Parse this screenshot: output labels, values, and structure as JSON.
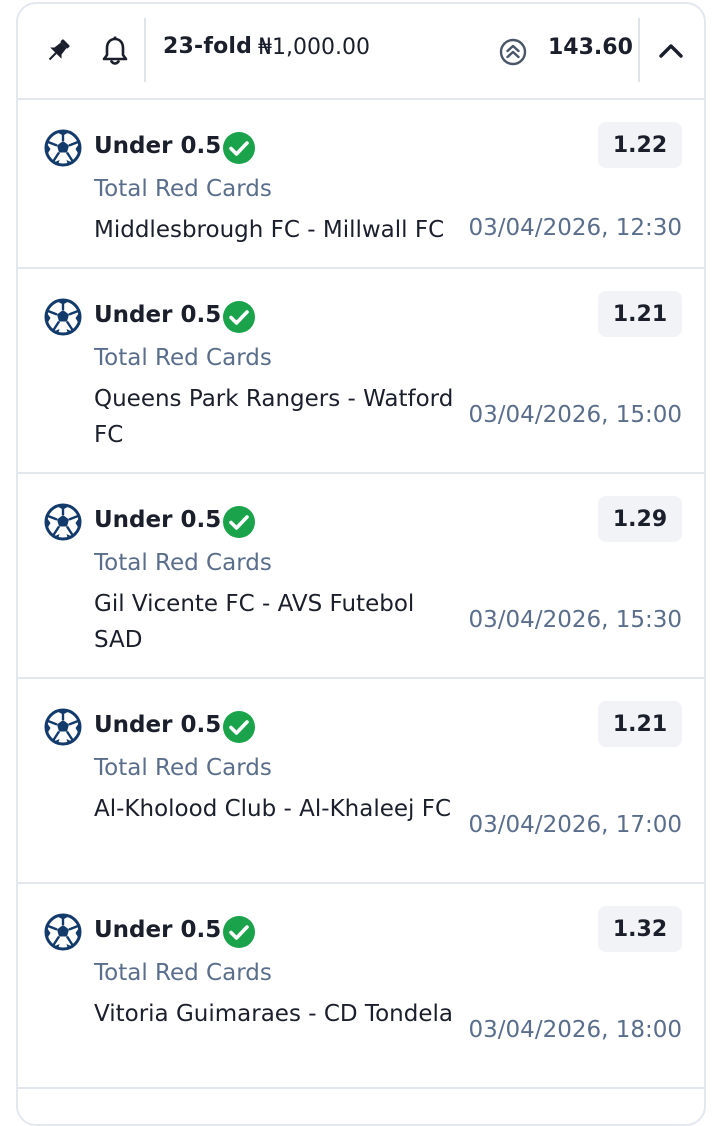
{
  "header": {
    "pin_icon": "pin-icon",
    "bell_icon": "bell-icon",
    "folds": "23-fold",
    "stake": "₦1,000.00",
    "boost_icon": "odds-boost-icon",
    "total_odds": "143.60",
    "collapse_icon": "chevron-up-icon"
  },
  "colors": {
    "win_green": "#1aa34a",
    "ball_navy": "#123a6b",
    "muted_text": "#5a6e8c",
    "odds_bg": "#f1f3f6"
  },
  "selections": [
    {
      "pick": "Under 0.5",
      "status": "won",
      "odds": "1.22",
      "market": "Total Red Cards",
      "event": "Middlesbrough FC - Millwall FC",
      "datetime": "03/04/2026, 12:30"
    },
    {
      "pick": "Under 0.5",
      "status": "won",
      "odds": "1.21",
      "market": "Total Red Cards",
      "event": "Queens Park Rangers - Watford FC",
      "datetime": "03/04/2026, 15:00"
    },
    {
      "pick": "Under 0.5",
      "status": "won",
      "odds": "1.29",
      "market": "Total Red Cards",
      "event": "Gil Vicente FC - AVS Futebol SAD",
      "datetime": "03/04/2026, 15:30"
    },
    {
      "pick": "Under 0.5",
      "status": "won",
      "odds": "1.21",
      "market": "Total Red Cards",
      "event": "Al-Kholood Club - Al-Khaleej FC",
      "datetime": "03/04/2026, 17:00"
    },
    {
      "pick": "Under 0.5",
      "status": "won",
      "odds": "1.32",
      "market": "Total Red Cards",
      "event": "Vitoria Guimaraes - CD Tondela",
      "datetime": "03/04/2026, 18:00"
    }
  ]
}
